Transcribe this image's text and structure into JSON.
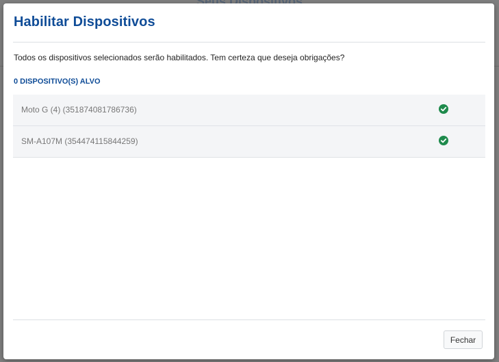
{
  "background": {
    "title": "Seus Dispositivos"
  },
  "modal": {
    "title": "Habilitar Dispositivos",
    "message": "Todos os dispositivos selecionados serão habilitados. Tem certeza que deseja obrigações?",
    "target_count_label": "0 DISPOSITIVO(S) ALVO",
    "devices": [
      {
        "name": "Moto G (4) (351874081786736)",
        "status_icon": "check-circle-icon"
      },
      {
        "name": "SM-A107M (354474115844259)",
        "status_icon": "check-circle-icon"
      }
    ],
    "close_label": "Fechar"
  },
  "colors": {
    "accent": "#0f4c97",
    "success": "#1e8a4c"
  }
}
